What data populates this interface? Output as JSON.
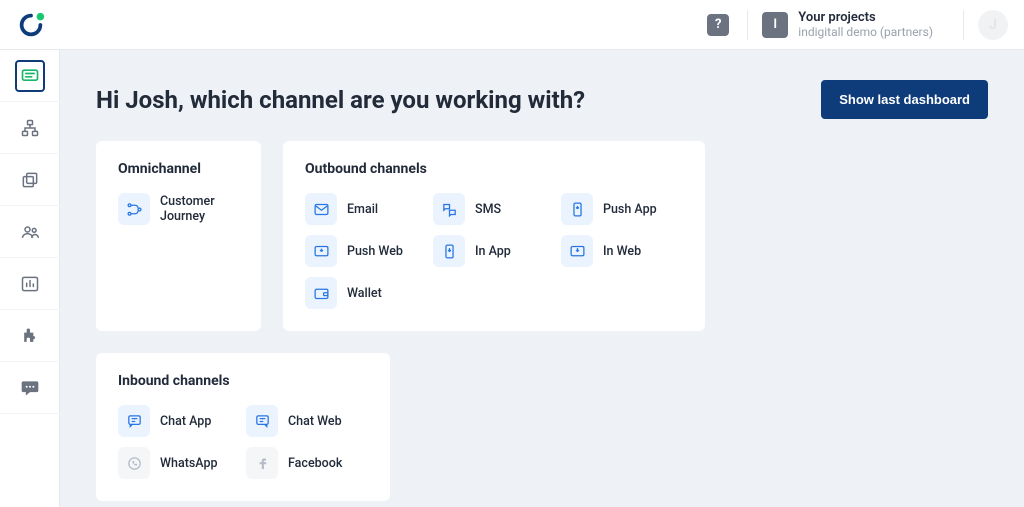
{
  "top": {
    "help_glyph": "?",
    "project_badge": "I",
    "project_title": "Your projects",
    "project_sub": "indigitall demo (partners)",
    "avatar_initial": "J"
  },
  "main": {
    "title": "Hi Josh, which channel are you working with?",
    "dashboard_button": "Show last dashboard"
  },
  "omni": {
    "heading": "Omnichannel",
    "item_label": "Customer Journey"
  },
  "outbound": {
    "heading": "Outbound channels",
    "items": [
      {
        "label": "Email"
      },
      {
        "label": "SMS"
      },
      {
        "label": "Push App"
      },
      {
        "label": "Push Web"
      },
      {
        "label": "In App"
      },
      {
        "label": "In Web"
      },
      {
        "label": "Wallet"
      }
    ]
  },
  "inbound": {
    "heading": "Inbound channels",
    "items": [
      {
        "label": "Chat App"
      },
      {
        "label": "Chat Web"
      },
      {
        "label": "WhatsApp"
      },
      {
        "label": "Facebook"
      }
    ]
  }
}
